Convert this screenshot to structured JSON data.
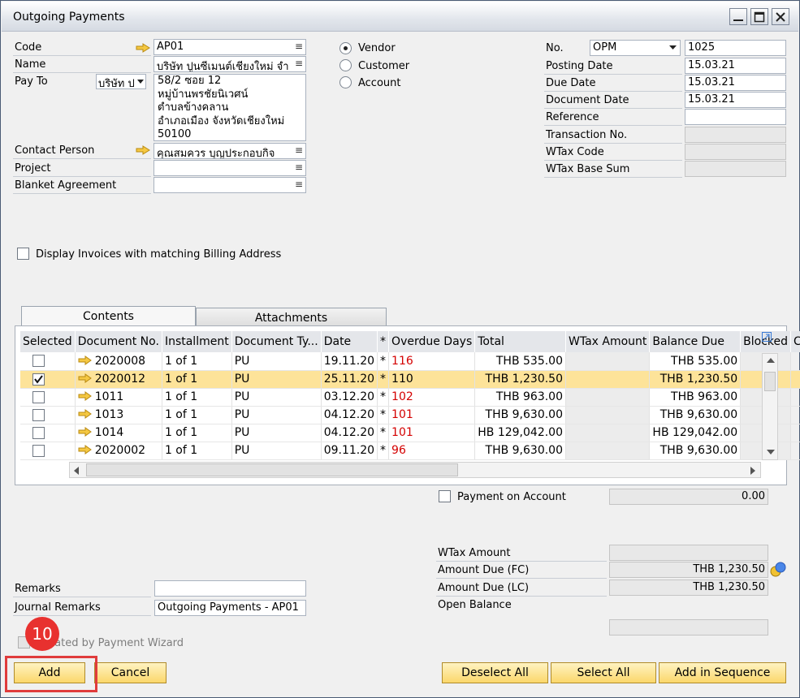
{
  "window": {
    "title": "Outgoing Payments"
  },
  "header": {
    "code_label": "Code",
    "code_value": "AP01",
    "name_label": "Name",
    "name_value": "บริษัท ปูนซีเมนต์เชียงใหม่ จำ",
    "payto_label": "Pay To",
    "payto_select": "บริษัท ป",
    "payto_address": [
      "58/2 ซอย 12",
      "หมู่บ้านพรชัยนิเวศน์",
      "ตำบลข้างคลาน",
      "อำเภอเมือง  จังหวัดเชียงใหม่",
      "50100"
    ],
    "contact_label": "Contact Person",
    "contact_value": "คุณสมควร บุญประกอบกิจ",
    "project_label": "Project",
    "project_value": "",
    "blanket_label": "Blanket Agreement",
    "blanket_value": ""
  },
  "partner_type": {
    "vendor": "Vendor",
    "customer": "Customer",
    "account": "Account",
    "selected": "vendor"
  },
  "doc": {
    "no_label": "No.",
    "series": "OPM",
    "number": "1025",
    "posting_label": "Posting Date",
    "posting_value": "15.03.21",
    "due_label": "Due Date",
    "due_value": "15.03.21",
    "docdate_label": "Document Date",
    "docdate_value": "15.03.21",
    "reference_label": "Reference",
    "reference_value": "",
    "transaction_label": "Transaction No.",
    "wtaxcode_label": "WTax Code",
    "wtaxbase_label": "WTax Base Sum"
  },
  "display_invoices_label": "Display Invoices with matching Billing Address",
  "tabs": {
    "contents": "Contents",
    "attachments": "Attachments"
  },
  "table": {
    "columns": [
      "Selected",
      "Document No.",
      "Installment",
      "Document Ty...",
      "Date",
      "*",
      "Overdue Days",
      "Total",
      "WTax Amount",
      "Balance Due",
      "Blocked",
      "Cash ..."
    ],
    "rows": [
      {
        "doc": "2020008",
        "inst": "1 of 1",
        "type": "PU",
        "date": "19.11.20",
        "star": "*",
        "overdue": "116",
        "total": "THB 535.00",
        "balance": "THB 535.00",
        "checked": false
      },
      {
        "doc": "2020012",
        "inst": "1 of 1",
        "type": "PU",
        "date": "25.11.20",
        "star": "*",
        "overdue": "110",
        "total": "THB 1,230.50",
        "balance": "THB 1,230.50",
        "checked": true
      },
      {
        "doc": "1011",
        "inst": "1 of 1",
        "type": "PU",
        "date": "03.12.20",
        "star": "*",
        "overdue": "102",
        "total": "THB 963.00",
        "balance": "THB 963.00",
        "checked": false
      },
      {
        "doc": "1013",
        "inst": "1 of 1",
        "type": "PU",
        "date": "04.12.20",
        "star": "*",
        "overdue": "101",
        "total": "THB 9,630.00",
        "balance": "THB 9,630.00",
        "checked": false
      },
      {
        "doc": "1014",
        "inst": "1 of 1",
        "type": "PU",
        "date": "04.12.20",
        "star": "*",
        "overdue": "101",
        "total": "HB 129,042.00",
        "balance": "HB 129,042.00",
        "checked": false
      },
      {
        "doc": "2020002",
        "inst": "1 of 1",
        "type": "PU",
        "date": "09.11.20",
        "star": "*",
        "overdue": "96",
        "total": "THB 9,630.00",
        "balance": "THB 9,630.00",
        "checked": false
      }
    ]
  },
  "totals": {
    "payment_on_account_label": "Payment on Account",
    "payment_on_account_value": "0.00",
    "wtax_label": "WTax Amount",
    "amount_fc_label": "Amount Due (FC)",
    "amount_fc_value": "THB 1,230.50",
    "amount_lc_label": "Amount Due (LC)",
    "amount_lc_value": "THB 1,230.50",
    "open_balance_label": "Open Balance"
  },
  "footer": {
    "remarks_label": "Remarks",
    "remarks_value": "",
    "journal_label": "Journal Remarks",
    "journal_value": "Outgoing Payments - AP01",
    "wizard_label": "Created by Payment Wizard",
    "add": "Add",
    "cancel": "Cancel",
    "deselect_all": "Deselect All",
    "select_all": "Select All",
    "add_in_sequence": "Add in Sequence"
  },
  "annotation": {
    "step": "10",
    "color": "#e8312f"
  }
}
